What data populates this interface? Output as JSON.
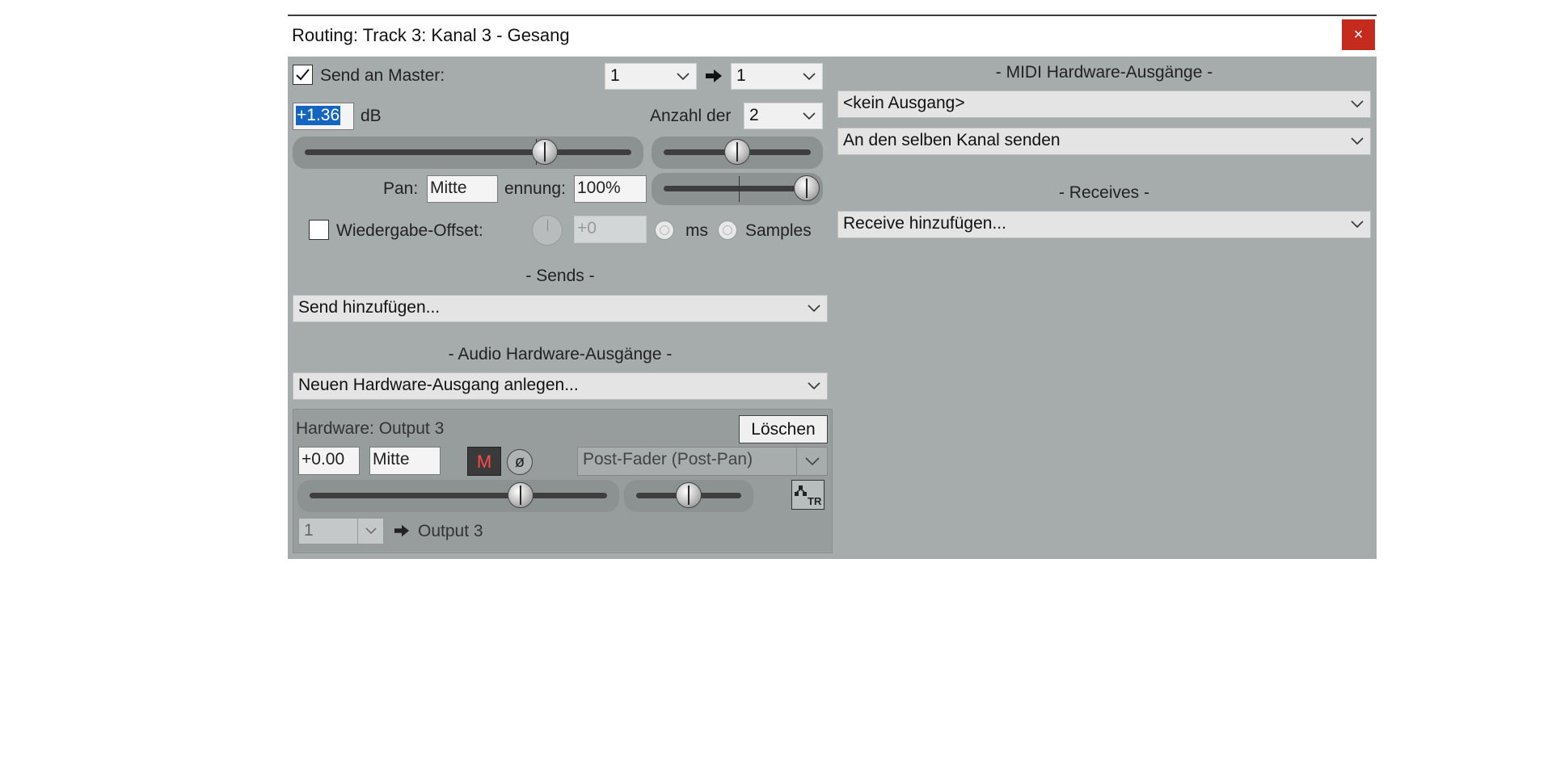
{
  "window": {
    "title": "Routing: Track 3: Kanal 3 - Gesang",
    "close_label": "×",
    "accent_close": "#c42b1c"
  },
  "master": {
    "send_label": "Send an Master:",
    "send_checked": true,
    "source_channel": "1",
    "dest_channel": "1",
    "volume_value": "+1.36",
    "volume_unit": "dB",
    "channels_label": "Anzahl der",
    "channels_value": "2",
    "pan_label": "Pan:",
    "pan_value": "Mitte",
    "width_label": "ennung:",
    "width_value": "100%",
    "offset_label": "Wiedergabe-Offset:",
    "offset_checked": false,
    "offset_value": "+0",
    "ms_label": "ms",
    "samples_label": "Samples"
  },
  "sends": {
    "header": "- Sends -",
    "add_label": "Send hinzufügen..."
  },
  "audio_hw": {
    "header": "- Audio Hardware-Ausgänge -",
    "add_label": "Neuen Hardware-Ausgang anlegen...",
    "output": {
      "name": "Hardware: Output 3",
      "delete_label": "Löschen",
      "volume_value": "+0.00",
      "pan_value": "Mitte",
      "mute_label": "M",
      "phase_label": "ø",
      "mode_value": "Post-Fader (Post-Pan)",
      "channel_value": "1",
      "dest_label": "Output 3"
    }
  },
  "midi_hw": {
    "header": "- MIDI Hardware-Ausgänge -",
    "output_value": "<kein Ausgang>",
    "channel_value": "An den selben Kanal senden"
  },
  "receives": {
    "header": "- Receives -",
    "add_label": "Receive hinzufügen..."
  }
}
